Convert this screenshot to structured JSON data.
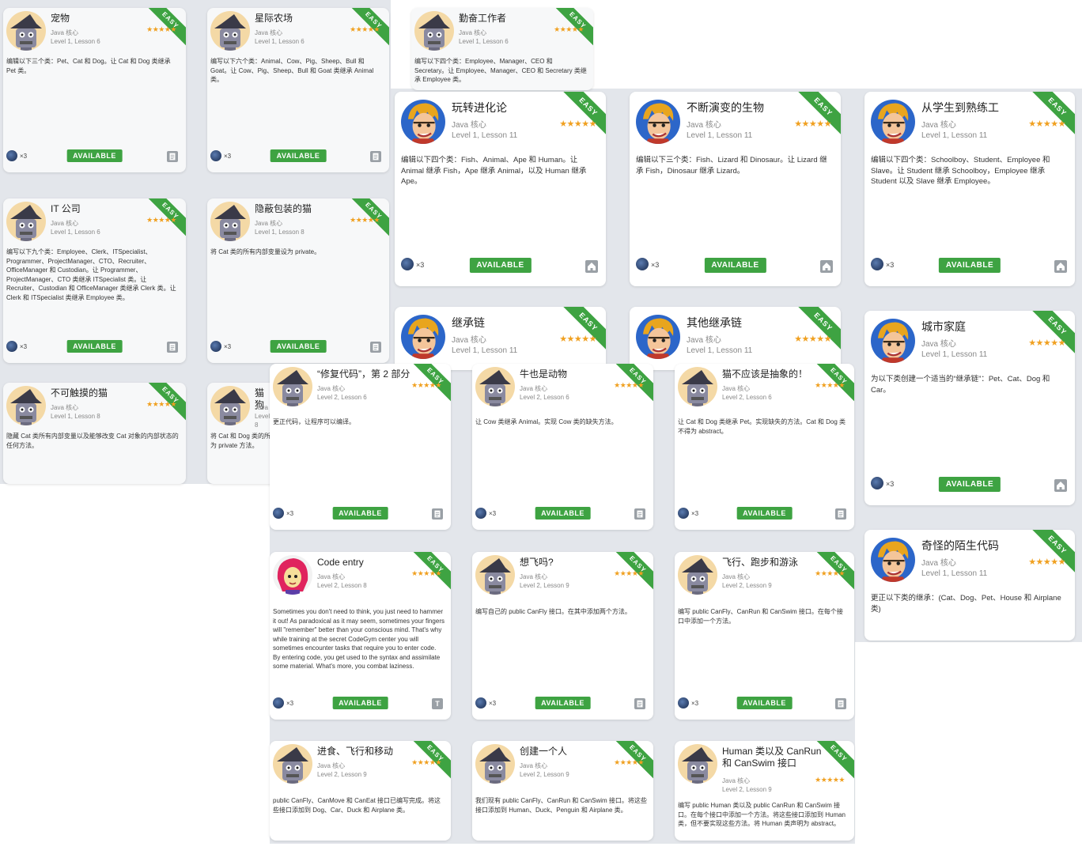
{
  "colors": {
    "ribbon": "#3ea342",
    "button": "#3ea342",
    "stars": "#f0a020",
    "panel": "#e3e6eb"
  },
  "common": {
    "ribbon": "EASY",
    "subject": "Java 核心",
    "button": "AVAILABLE",
    "multiplier": "×3",
    "stars": "★★★★★"
  },
  "cards": {
    "c1": {
      "title": "宠物",
      "lesson": "Level 1, Lesson 6",
      "desc": "编辑以下三个类：Pet、Cat 和 Dog。让 Cat 和 Dog 类继承 Pet 类。",
      "corner": "document-icon"
    },
    "c2": {
      "title": "星际农场",
      "lesson": "Level 1, Lesson 6",
      "desc": "编写以下六个类：Animal、Cow、Pig、Sheep、Bull 和 Goat。让 Cow、Pig、Sheep、Bull 和 Goat 类继承 Animal 类。",
      "corner": "document-icon"
    },
    "c3": {
      "title": "勤奋工作者",
      "lesson": "Level 1, Lesson 6",
      "desc": "编写以下四个类：Employee、Manager、CEO 和 Secretary。让 Employee、Manager、CEO 和 Secretary 类继承 Employee 类。",
      "corner": "document-icon"
    },
    "c4": {
      "title": "玩转进化论",
      "lesson": "Level 1, Lesson 11",
      "desc": "编辑以下四个类：Fish、Animal、Ape 和 Human。让 Animal 继承 Fish，Ape 继承 Animal，以及 Human 继承 Ape。",
      "corner": "home-icon"
    },
    "c5": {
      "title": "不断演变的生物",
      "lesson": "Level 1, Lesson 11",
      "desc": "编辑以下三个类：Fish、Lizard 和 Dinosaur。让 Lizard 继承 Fish，Dinosaur 继承 Lizard。",
      "corner": "home-icon"
    },
    "c6": {
      "title": "从学生到熟练工",
      "lesson": "Level 1, Lesson 11",
      "desc": "编辑以下四个类：Schoolboy、Student、Employee 和 Slave。让 Student 继承 Schoolboy，Employee 继承 Student 以及 Slave 继承 Employee。",
      "corner": "home-icon"
    },
    "c7": {
      "title": "IT 公司",
      "lesson": "Level 1, Lesson 6",
      "desc": "编写以下九个类：Employee、Clerk、ITSpecialist、Programmer、ProjectManager、CTO、Recruiter、OfficeManager 和 Custodian。让 Programmer、ProjectManager、CTO 类继承 ITSpecialist 类。让 Recruiter、Custodian 和 OfficeManager 类继承 Clerk 类。让 Clerk 和 ITSpecialist 类继承 Employee 类。",
      "corner": "document-icon"
    },
    "c8": {
      "title": "隐蔽包装的猫",
      "lesson": "Level 1, Lesson 8",
      "desc": "将 Cat 类的所有内部变量设为 private。",
      "corner": "document-icon"
    },
    "c9": {
      "title": "继承链",
      "lesson": "Level 1, Lesson 11",
      "desc": "",
      "corner": "home-icon"
    },
    "c10": {
      "title": "其他继承链",
      "lesson": "Level 1, Lesson 11",
      "desc": "",
      "corner": "home-icon"
    },
    "c11": {
      "title": "城市家庭",
      "lesson": "Level 1, Lesson 11",
      "desc": "为以下类创建一个适当的“继承链”：Pet、Cat、Dog 和 Car。",
      "corner": "home-icon"
    },
    "c12": {
      "title": "不可触摸的猫",
      "lesson": "Level 1, Lesson 8",
      "desc": "隐藏 Cat 类所有内部变量以及能够改变 Cat 对象的内部状态的任何方法。",
      "corner": "document-icon"
    },
    "c13": {
      "title": "猫狗",
      "lesson": "Level 1, Lesson 8",
      "desc": "将 Cat 和 Dog 类的所有方法设为 private 方法。",
      "corner": "document-icon"
    },
    "c14": {
      "title": "“修复代码”，第 2 部分",
      "lesson": "Level 2, Lesson 6",
      "desc": "更正代码，让程序可以编译。",
      "corner": "document-icon"
    },
    "c15": {
      "title": "牛也是动物",
      "lesson": "Level 2, Lesson 6",
      "desc": "让 Cow 类继承 Animal。实现 Cow 类的缺失方法。",
      "corner": "document-icon"
    },
    "c16": {
      "title": "猫不应该是抽象的！",
      "lesson": "Level 2, Lesson 6",
      "desc": "让 Cat 和 Dog 类继承 Pet。实现缺失的方法。Cat 和 Dog 类不得为 abstract。",
      "corner": "document-icon"
    },
    "c17": {
      "title": "奇怪的陌生代码",
      "lesson": "Level 1, Lesson 11",
      "desc": "更正以下类的继承：(Cat、Dog、Pet、House 和 Airplane 类)",
      "corner": "home-icon"
    },
    "c18": {
      "title": "Code entry",
      "lesson": "Level 2, Lesson 8",
      "desc": "Sometimes you don't need to think, you just need to hammer it out! As paradoxical as it may seem, sometimes your fingers will \"remember\" better than your conscious mind. That's why while training at the secret CodeGym center you will sometimes encounter tasks that require you to enter code. By entering code, you get used to the syntax and assimilate some material. What's more, you combat laziness.",
      "corner": "text-icon",
      "corner_text": "T"
    },
    "c19": {
      "title": "想飞吗?",
      "lesson": "Level 2, Lesson 9",
      "desc": "编写自己的 public CanFly 接口。在其中添加两个方法。",
      "corner": "document-icon"
    },
    "c20": {
      "title": "飞行、跑步和游泳",
      "lesson": "Level 2, Lesson 9",
      "desc": "编写 public CanFly、CanRun 和 CanSwim 接口。在每个接口中添加一个方法。",
      "corner": "document-icon"
    },
    "c21": {
      "title": "进食、飞行和移动",
      "lesson": "Level 2, Lesson 9",
      "desc": "public CanFly、CanMove 和 CanEat 接口已编写完成。将这些接口添加到 Dog、Car、Duck 和 Airplane 类。",
      "corner": "document-icon"
    },
    "c22": {
      "title": "创建一个人",
      "lesson": "Level 2, Lesson 9",
      "desc": "我们现有 public CanFly、CanRun 和 CanSwim 接口。将这些接口添加到 Human、Duck、Penguin 和 Airplane 类。",
      "corner": "document-icon"
    },
    "c23": {
      "title": "Human 类以及 CanRun 和 CanSwim 接口",
      "lesson": "Level 2, Lesson 9",
      "desc": "编写 public Human 类以及 public CanRun 和 CanSwim 接口。在每个接口中添加一个方法。将这些接口添加到 Human 类，但不要实现这些方法。将 Human 类声明为 abstract。",
      "corner": "document-icon"
    }
  }
}
